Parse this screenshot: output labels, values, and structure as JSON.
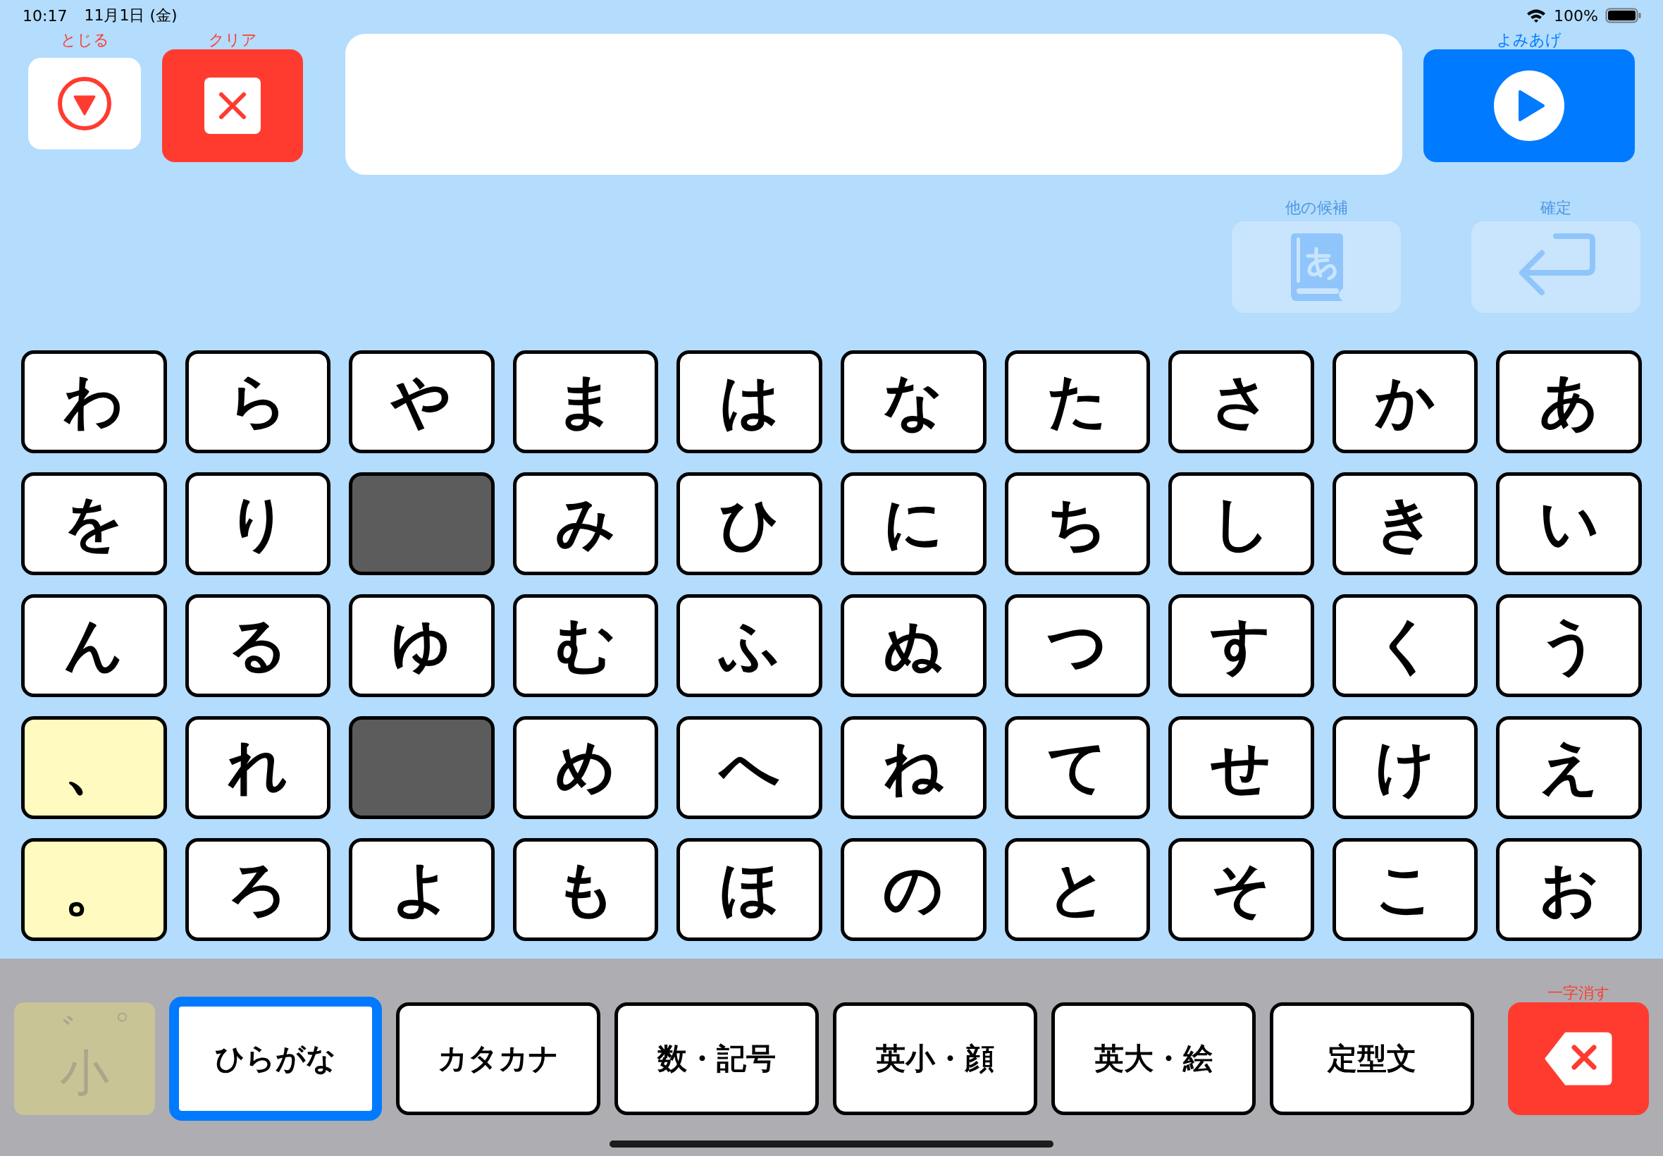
{
  "status_bar": {
    "time": "10:17",
    "date": "11月1日 (金)",
    "battery": "100%"
  },
  "top_buttons": [
    {
      "kind": "close",
      "label": "とじる"
    },
    {
      "kind": "clear",
      "label": "クリア"
    }
  ],
  "read_button": {
    "label": "よみあげ"
  },
  "candidate_buttons": [
    {
      "kind": "candidates",
      "label": "他の候補",
      "disabled": true
    },
    {
      "kind": "confirm",
      "label": "確定",
      "disabled": true
    }
  ],
  "keys": [
    [
      {
        "kind": "char",
        "label": "わ"
      },
      {
        "kind": "char",
        "label": "ら"
      },
      {
        "kind": "char",
        "label": "や"
      },
      {
        "kind": "char",
        "label": "ま"
      },
      {
        "kind": "char",
        "label": "は"
      },
      {
        "kind": "char",
        "label": "な"
      },
      {
        "kind": "char",
        "label": "た"
      },
      {
        "kind": "char",
        "label": "さ"
      },
      {
        "kind": "char",
        "label": "か"
      },
      {
        "kind": "char",
        "label": "あ"
      }
    ],
    [
      {
        "kind": "char",
        "label": "を"
      },
      {
        "kind": "char",
        "label": "り"
      },
      {
        "kind": "blank"
      },
      {
        "kind": "char",
        "label": "み"
      },
      {
        "kind": "char",
        "label": "ひ"
      },
      {
        "kind": "char",
        "label": "に"
      },
      {
        "kind": "char",
        "label": "ち"
      },
      {
        "kind": "char",
        "label": "し"
      },
      {
        "kind": "char",
        "label": "き"
      },
      {
        "kind": "char",
        "label": "い"
      }
    ],
    [
      {
        "kind": "char",
        "label": "ん"
      },
      {
        "kind": "char",
        "label": "る"
      },
      {
        "kind": "char",
        "label": "ゆ"
      },
      {
        "kind": "char",
        "label": "む"
      },
      {
        "kind": "char",
        "label": "ふ"
      },
      {
        "kind": "char",
        "label": "ぬ"
      },
      {
        "kind": "char",
        "label": "つ"
      },
      {
        "kind": "char",
        "label": "す"
      },
      {
        "kind": "char",
        "label": "く"
      },
      {
        "kind": "char",
        "label": "う"
      }
    ],
    [
      {
        "kind": "punct",
        "label": "、"
      },
      {
        "kind": "char",
        "label": "れ"
      },
      {
        "kind": "blank"
      },
      {
        "kind": "char",
        "label": "め"
      },
      {
        "kind": "char",
        "label": "へ"
      },
      {
        "kind": "char",
        "label": "ね"
      },
      {
        "kind": "char",
        "label": "て"
      },
      {
        "kind": "char",
        "label": "せ"
      },
      {
        "kind": "char",
        "label": "け"
      },
      {
        "kind": "char",
        "label": "え"
      }
    ],
    [
      {
        "kind": "punct",
        "label": "。"
      },
      {
        "kind": "char",
        "label": "ろ"
      },
      {
        "kind": "char",
        "label": "よ"
      },
      {
        "kind": "char",
        "label": "も"
      },
      {
        "kind": "char",
        "label": "ほ"
      },
      {
        "kind": "char",
        "label": "の"
      },
      {
        "kind": "char",
        "label": "と"
      },
      {
        "kind": "char",
        "label": "そ"
      },
      {
        "kind": "char",
        "label": "こ"
      },
      {
        "kind": "char",
        "label": "お"
      }
    ]
  ],
  "modifier_key": {
    "marks": "゛゜",
    "label": "小",
    "disabled": true
  },
  "mode_tabs": [
    {
      "label": "ひらがな",
      "selected": true
    },
    {
      "label": "カタカナ",
      "selected": false
    },
    {
      "label": "数・記号",
      "selected": false
    },
    {
      "label": "英小・顔",
      "selected": false
    },
    {
      "label": "英大・絵",
      "selected": false
    },
    {
      "label": "定型文",
      "selected": false
    }
  ],
  "delete_button": {
    "label": "一字消す"
  }
}
